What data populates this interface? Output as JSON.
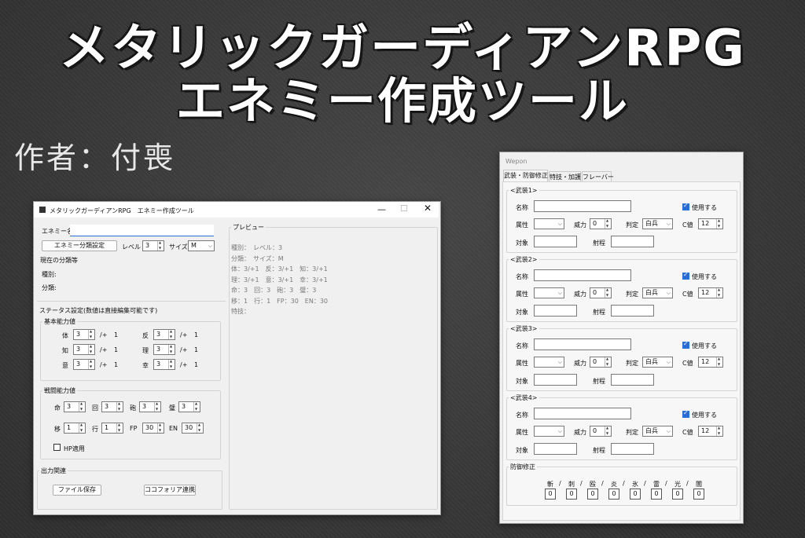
{
  "title_line1": "メタリックガーディアンRPG",
  "title_line2": "エネミー作成ツール",
  "author": "作者：付喪",
  "main": {
    "window_title": "メタリックガーディアンRPG　エネミー作成ツール",
    "enemy_name_label": "エネミー名",
    "enemy_name_value": "",
    "class_button": "エネミー分類設定",
    "level_label": "レベル",
    "level_value": "3",
    "size_label": "サイズ",
    "size_value": "M",
    "current_class_label": "現在の分類等",
    "type_label": "種別:",
    "category_label": "分類:",
    "status_group": "ステータス設定(数値は直接編集可能です)",
    "basic_group": "基本能力値",
    "basic": [
      {
        "name": "体",
        "value": "3",
        "bonus": "/+",
        "bonus_val": "1"
      },
      {
        "name": "反",
        "value": "3",
        "bonus": "/+",
        "bonus_val": "1"
      },
      {
        "name": "知",
        "value": "3",
        "bonus": "/+",
        "bonus_val": "1"
      },
      {
        "name": "理",
        "value": "3",
        "bonus": "/+",
        "bonus_val": "1"
      },
      {
        "name": "意",
        "value": "3",
        "bonus": "/+",
        "bonus_val": "1"
      },
      {
        "name": "幸",
        "value": "3",
        "bonus": "/+",
        "bonus_val": "1"
      }
    ],
    "battle_group": "戦闘能力値",
    "battle": [
      {
        "name": "命",
        "value": "3"
      },
      {
        "name": "回",
        "value": "3"
      },
      {
        "name": "砲",
        "value": "3"
      },
      {
        "name": "璧",
        "value": "3"
      },
      {
        "name": "移",
        "value": "1"
      },
      {
        "name": "行",
        "value": "1"
      },
      {
        "name": "FP",
        "value": "30"
      },
      {
        "name": "EN",
        "value": "30"
      }
    ],
    "hp_label": "HP適用",
    "output_group": "出力関連",
    "save_button": "ファイル保存",
    "cocofolia_button": "ココフォリア連携",
    "preview_group": "プレビュー",
    "preview_lines": [
      "種別：　レベル：3",
      "分類：　サイズ：M",
      "体：3/+1　反：3/+1　知：3/+1",
      "理：3/+1　意：3/+1　幸：3/+1",
      "命：3　回：3　砲：3　璧：3",
      "移：1　行：1　FP：30　EN：30",
      "特技："
    ]
  },
  "weapon": {
    "window_title": "Wepon",
    "tabs": [
      "武装・防御修正",
      "特技・加護",
      "フレーバー"
    ],
    "weapons": [
      {
        "group": "<武装1>"
      },
      {
        "group": "<武装2>"
      },
      {
        "group": "<武装3>"
      },
      {
        "group": "<武装4>"
      }
    ],
    "name_label": "名称",
    "use_label": "使用する",
    "attr_label": "属性",
    "power_label": "威力",
    "power_value": "0",
    "judge_label": "判定",
    "judge_value": "白兵",
    "c_label": "C値",
    "c_value": "12",
    "target_label": "対象",
    "range_label": "射程",
    "defense_group": "防御修正",
    "defense": [
      {
        "name": "斬",
        "value": "0"
      },
      {
        "name": "刺",
        "value": "0"
      },
      {
        "name": "殴",
        "value": "0"
      },
      {
        "name": "炎",
        "value": "0"
      },
      {
        "name": "氷",
        "value": "0"
      },
      {
        "name": "雷",
        "value": "0"
      },
      {
        "name": "光",
        "value": "0"
      },
      {
        "name": "闇",
        "value": "0"
      }
    ]
  }
}
